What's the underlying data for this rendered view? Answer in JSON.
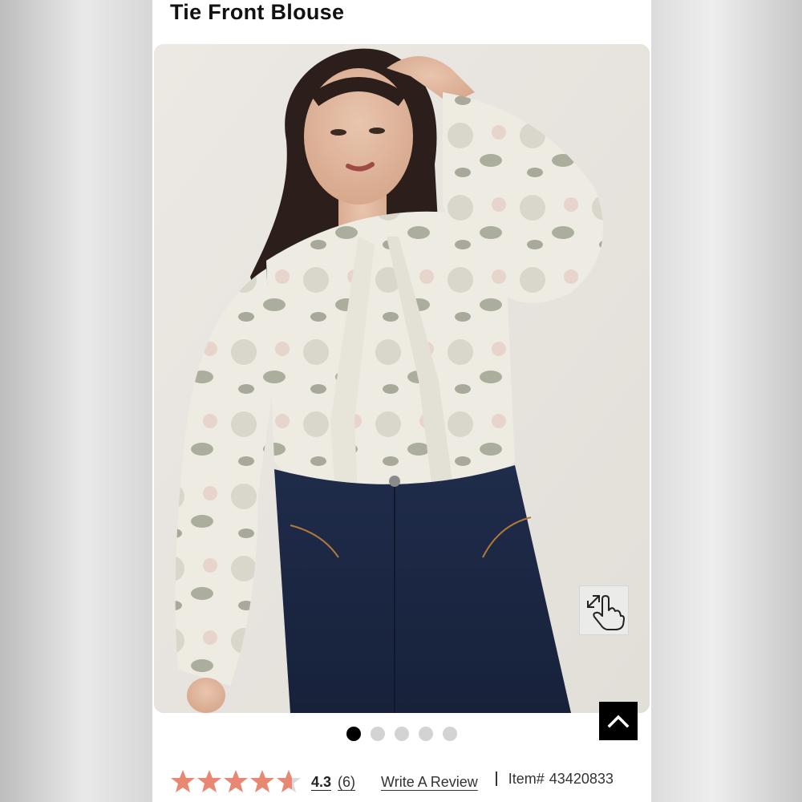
{
  "product": {
    "title": "Tie Front Blouse",
    "image_alt": "Model wearing floral tie front blouse with dark jeans"
  },
  "gallery": {
    "total_images": 5,
    "active_index": 0,
    "zoom_icon": "zoom-tap-icon",
    "back_to_top_icon": "chevron-up-icon"
  },
  "reviews": {
    "rating": "4.3",
    "rating_numeric": 4.3,
    "max_rating": 5,
    "count_label": "(6)",
    "write_review_label": "Write A Review",
    "star_color": "#e88873",
    "star_empty_color": "#d9d9d9"
  },
  "item": {
    "label": "Item#",
    "number": "43420833"
  }
}
